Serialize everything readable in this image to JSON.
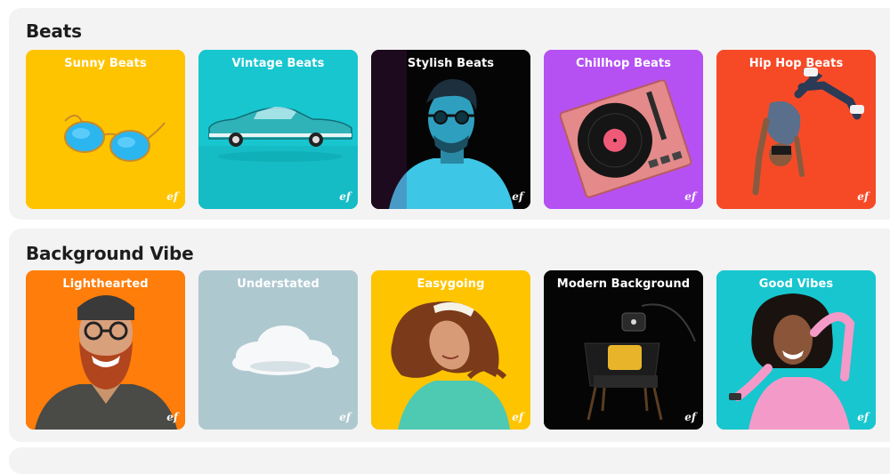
{
  "sections": [
    {
      "title": "Beats",
      "cards": [
        {
          "title": "Sunny Beats",
          "bg": "#ffc400",
          "art": "sunglasses"
        },
        {
          "title": "Vintage Beats",
          "bg": "#18c6cf",
          "art": "classic-car"
        },
        {
          "title": "Stylish Beats",
          "bg": "#050505",
          "art": "man-neon"
        },
        {
          "title": "Chillhop Beats",
          "bg": "#b551f3",
          "art": "record-player"
        },
        {
          "title": "Hip Hop Beats",
          "bg": "#f64a27",
          "art": "breakdancer"
        }
      ]
    },
    {
      "title": "Background Vibe",
      "cards": [
        {
          "title": "Lighthearted",
          "bg": "#ff7d0a",
          "art": "bearded-man"
        },
        {
          "title": "Understated",
          "bg": "#aec8d0",
          "art": "cloud"
        },
        {
          "title": "Easygoing",
          "bg": "#ffc400",
          "art": "curly-woman"
        },
        {
          "title": "Modern Background",
          "bg": "#050505",
          "art": "armchair-lamp"
        },
        {
          "title": "Good Vibes",
          "bg": "#18c6cf",
          "art": "woman-headphones"
        }
      ]
    }
  ],
  "logo_mark": "ef"
}
